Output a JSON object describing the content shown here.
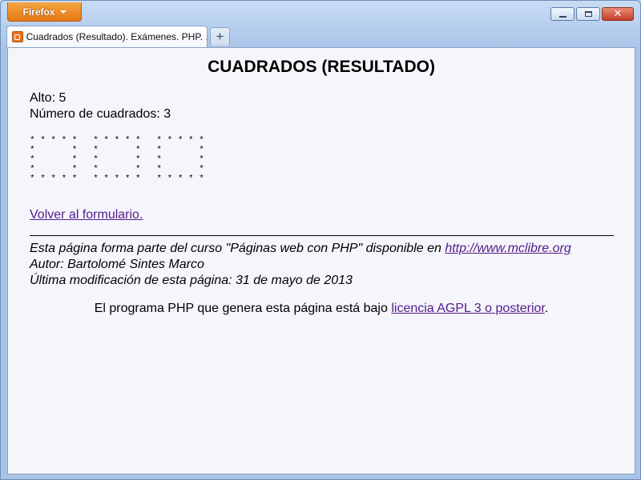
{
  "window": {
    "menu_button": "Firefox",
    "controls": {
      "minimize": "minimize",
      "maximize": "maximize",
      "close": "close"
    }
  },
  "tabs": [
    {
      "label": "Cuadrados (Resultado). Exámenes. PHP. ..."
    }
  ],
  "page": {
    "title": "CUADRADOS (RESULTADO)",
    "alto_line": "Alto: 5",
    "count_line": "Número de cuadrados: 3",
    "squares_art": "* * * * *   * * * * *   * * * * *\n*       *   *       *   *       *\n*       *   *       *   *       *\n*       *   *       *   *       *\n* * * * *   * * * * *   * * * * *",
    "back_link": "Volver al formulario.",
    "footer": {
      "line1_prefix": "Esta página forma parte del curso \"Páginas web con PHP\" disponible en ",
      "line1_link": "http://www.mclibre.org",
      "line2": "Autor: Bartolomé Sintes Marco",
      "line3": "Última modificación de esta página: 31 de mayo de 2013"
    },
    "license": {
      "prefix": "El programa PHP que genera esta página está bajo ",
      "link": "licencia AGPL 3 o posterior",
      "suffix": "."
    }
  },
  "colors": {
    "firefox_button": "#e47812",
    "link": "#551a8b",
    "content_bg": "#f5f6fb",
    "close_button": "#c3402a"
  },
  "icons": {
    "menu_caret": "chevron-down-icon",
    "tab_favicon": "xampp-icon",
    "new_tab": "plus-icon"
  }
}
